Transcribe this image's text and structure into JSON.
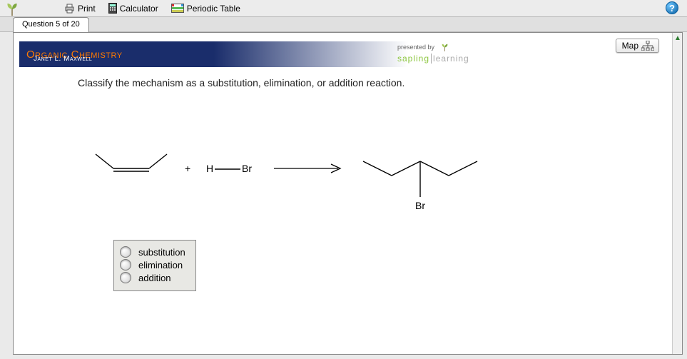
{
  "logo": {
    "name": "sapling-leaf-icon"
  },
  "topbar": {
    "print": "Print",
    "calculator": "Calculator",
    "periodic": "Periodic Table"
  },
  "tab": {
    "label": "Question 5 of 20"
  },
  "banner": {
    "title": "Organic Chemistry",
    "author": "Janet L. Maxwell",
    "presented": "presented by",
    "brand1": "sapling",
    "brand2": "learning"
  },
  "map": {
    "label": "Map"
  },
  "prompt": "Classify the mechanism as a substitution, elimination, or addition reaction.",
  "reaction": {
    "plus": "+",
    "hbr_h": "H",
    "hbr_br": "Br",
    "product_label": "Br"
  },
  "options": [
    {
      "label": "substitution"
    },
    {
      "label": "elimination"
    },
    {
      "label": "addition"
    }
  ]
}
